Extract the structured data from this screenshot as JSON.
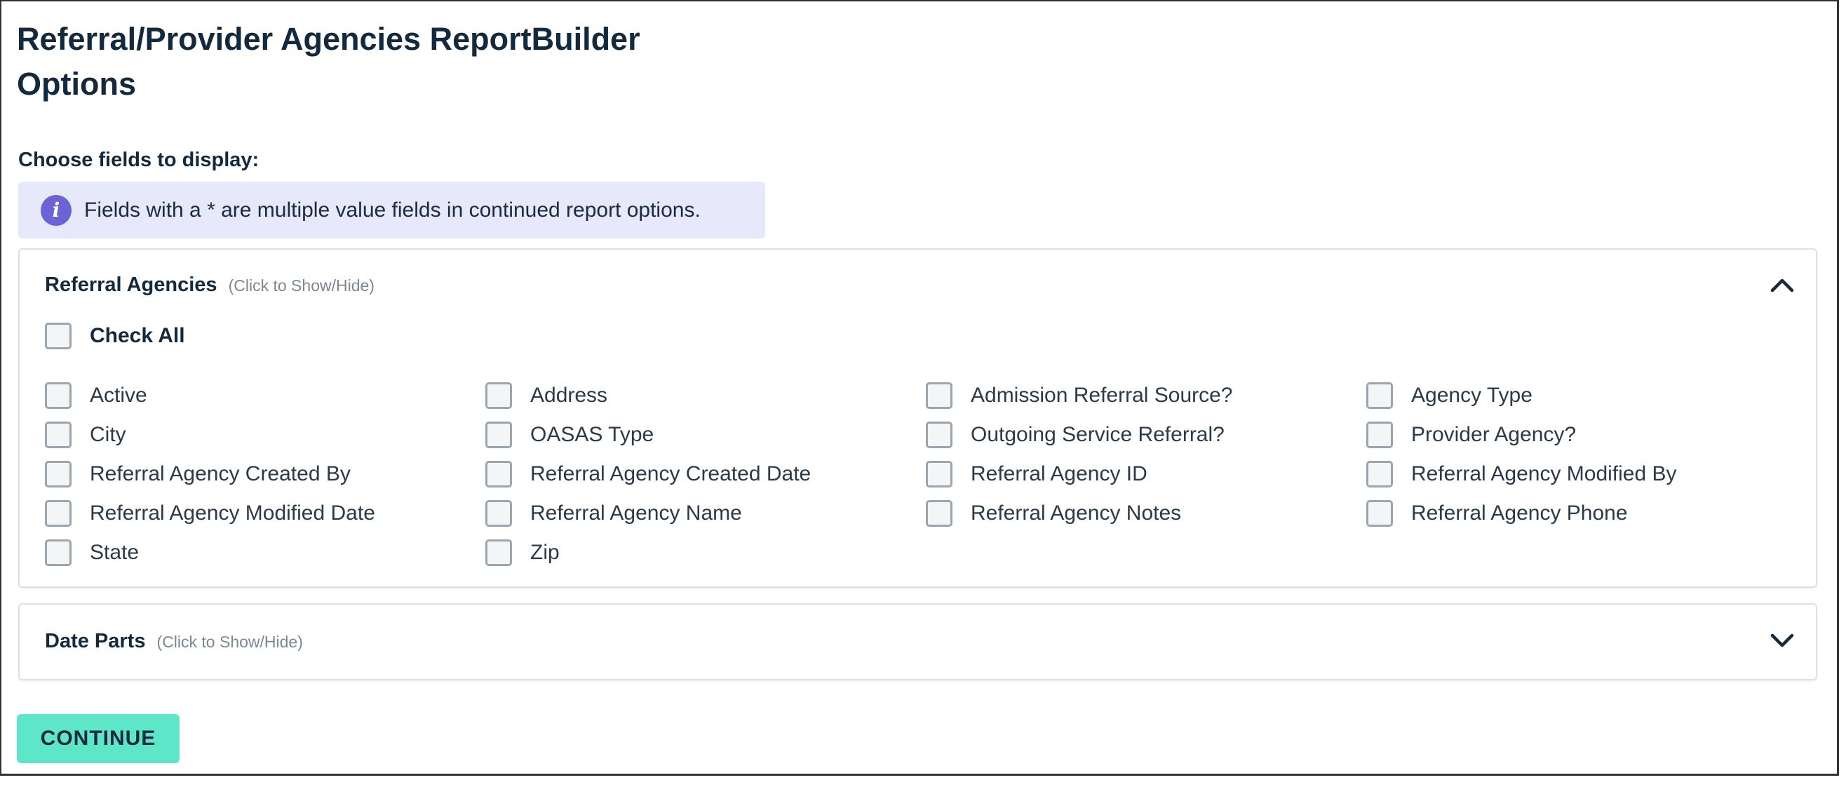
{
  "page": {
    "title_line1": "Referral/Provider Agencies ReportBuilder",
    "title_line2": "Options"
  },
  "choose_label": "Choose fields to display:",
  "info_banner": {
    "icon": "info-icon",
    "icon_glyph": "i",
    "text": "Fields with a * are multiple value fields in continued report options.",
    "color": "#e7e8f9"
  },
  "referral_panel": {
    "title": "Referral Agencies",
    "hint": "(Click to Show/Hide)",
    "expanded": true,
    "chevron_icon": "chevron-up-icon",
    "check_all_label": "Check All",
    "fields": [
      "Active",
      "Address",
      "Admission Referral Source?",
      "Agency Type",
      "City",
      "OASAS Type",
      "Outgoing Service Referral?",
      "Provider Agency?",
      "Referral Agency Created By",
      "Referral Agency Created Date",
      "Referral Agency ID",
      "Referral Agency Modified By",
      "Referral Agency Modified Date",
      "Referral Agency Name",
      "Referral Agency Notes",
      "Referral Agency Phone",
      "State",
      "Zip"
    ]
  },
  "date_panel": {
    "title": "Date Parts",
    "hint": "(Click to Show/Hide)",
    "expanded": false,
    "chevron_icon": "chevron-down-icon"
  },
  "continue_button": {
    "label": "CONTINUE",
    "color": "#5ee6c8"
  }
}
